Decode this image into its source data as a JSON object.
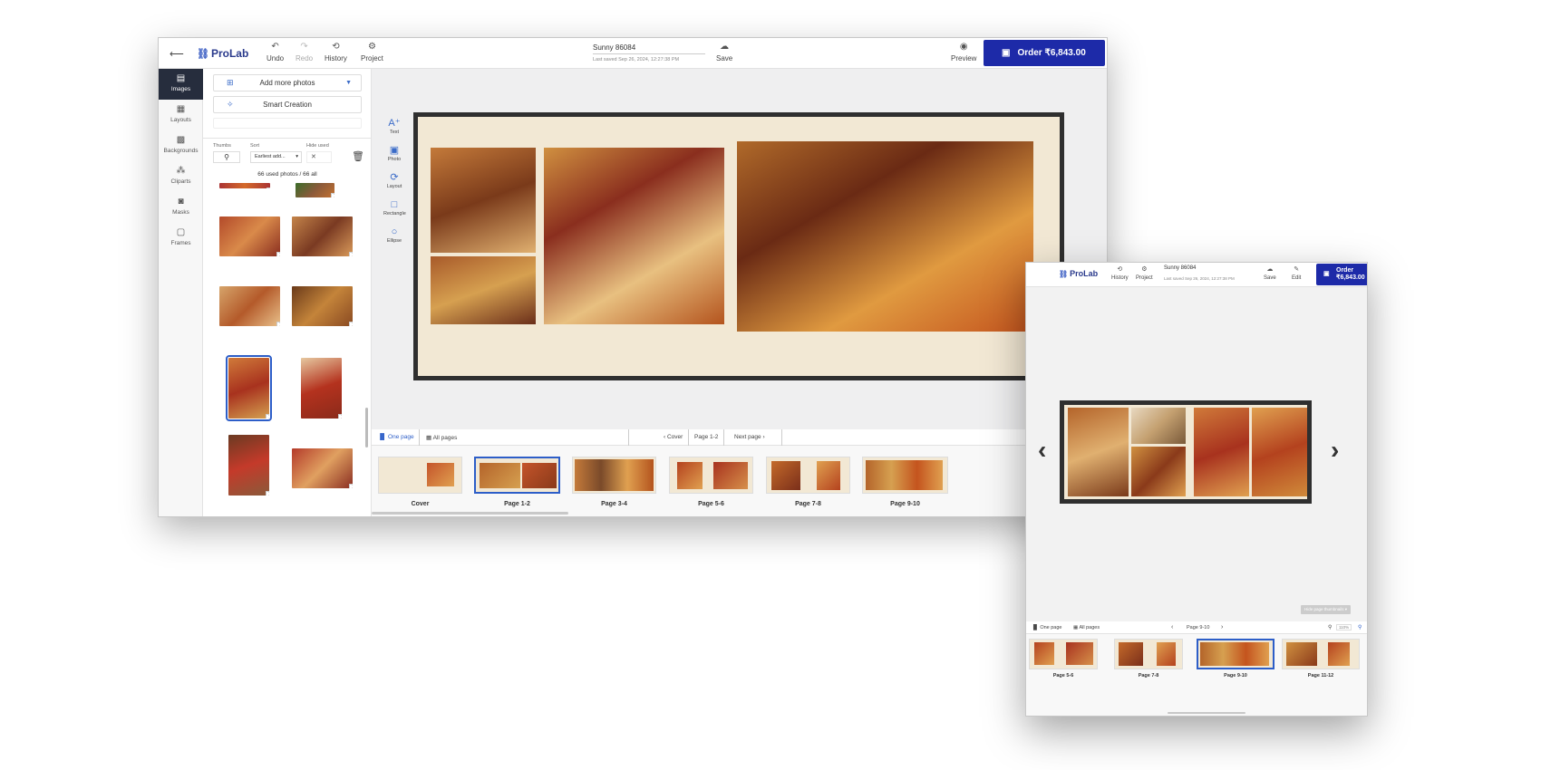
{
  "app": {
    "logo": "ProLab",
    "project_title": "Sunny 86084",
    "last_saved": "Last saved  Sep 26, 2024, 12:27:38 PM"
  },
  "toolbar": {
    "back_label": "⟵",
    "undo": "Undo",
    "redo": "Redo",
    "history": "History",
    "project": "Project",
    "save": "Save",
    "preview": "Preview",
    "order": "Order  ₹6,843.00"
  },
  "left_nav": {
    "items": [
      {
        "label": "Images",
        "icon": "images-icon"
      },
      {
        "label": "Layouts",
        "icon": "layouts-icon"
      },
      {
        "label": "Backgrounds",
        "icon": "backgrounds-icon"
      },
      {
        "label": "Cliparts",
        "icon": "cliparts-icon"
      },
      {
        "label": "Masks",
        "icon": "masks-icon"
      },
      {
        "label": "Frames",
        "icon": "frames-icon"
      }
    ]
  },
  "panel": {
    "add_more_photos": "Add more photos",
    "smart_creation": "Smart Creation",
    "thumbs_label": "Thumbs",
    "sort_label": "Sort",
    "sort_value": "Earliest add...",
    "hide_used_label": "Hide used",
    "photo_count": "66 used photos / 66 all",
    "thumb_badges": [
      "1",
      "1",
      "1",
      "1",
      "1",
      "1",
      "1",
      "1",
      "1",
      "1",
      "1",
      "1"
    ]
  },
  "tools": {
    "items": [
      "Text",
      "Photo",
      "Layout",
      "Rectangle",
      "Ellipse"
    ]
  },
  "page_nav": {
    "one_page": "One page",
    "all_pages": "All pages",
    "cover": "Cover",
    "current": "Page 1-2",
    "next": "Next page"
  },
  "page_strip": {
    "pages": [
      "Cover",
      "Page 1-2",
      "Page 3-4",
      "Page 5-6",
      "Page 7-8",
      "Page 9-10"
    ]
  },
  "mobile": {
    "toolbar": {
      "history": "History",
      "project": "Project",
      "save": "Save",
      "edit": "Edit",
      "order_line1": "Order",
      "order_line2": "₹6,843.00"
    },
    "hide_page_thumbnails": "Hide page thumbnails",
    "page_nav": {
      "one_page": "One page",
      "all_pages": "All pages",
      "current": "Page 9-10",
      "zoom": "110%"
    },
    "page_strip": {
      "pages": [
        "Page 5-6",
        "Page 7-8",
        "Page 9-10",
        "Page 11-12"
      ]
    }
  },
  "colors": {
    "accent": "#1d2aa8",
    "selection": "#2d5ec8",
    "album_bg": "#f2e8d4",
    "frame": "#2f2f2f"
  }
}
